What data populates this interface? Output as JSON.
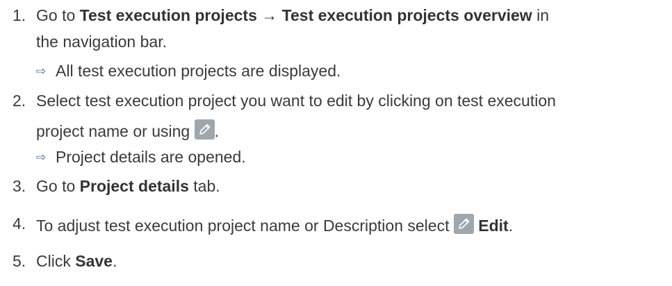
{
  "steps": [
    {
      "number": "1.",
      "pre": "Go to ",
      "bold1": "Test execution projects",
      "sep": " → ",
      "bold2": "Test execution projects overview",
      "post": " in",
      "line2": "the navigation bar.",
      "result": "All test execution projects are displayed."
    },
    {
      "number": "2.",
      "line1": "Select test execution project you want to edit by clicking on test execution",
      "line2_pre": "project name or using ",
      "line2_post": ".",
      "result": "Project details are opened."
    },
    {
      "number": "3.",
      "pre": "Go to ",
      "bold": "Project details",
      "post": " tab."
    },
    {
      "number": "4.",
      "pre": "To adjust test execution project name or Description select ",
      "bold": "Edit",
      "post": "."
    },
    {
      "number": "5.",
      "pre": "Click ",
      "bold": "Save",
      "post": "."
    }
  ],
  "icons": {
    "edit": "pencil-icon",
    "result_arrow": "arrow-right-icon"
  },
  "colors": {
    "text": "#3a3a3a",
    "arrow": "#2f6fa8",
    "icon_background": "#9ea7ad"
  }
}
